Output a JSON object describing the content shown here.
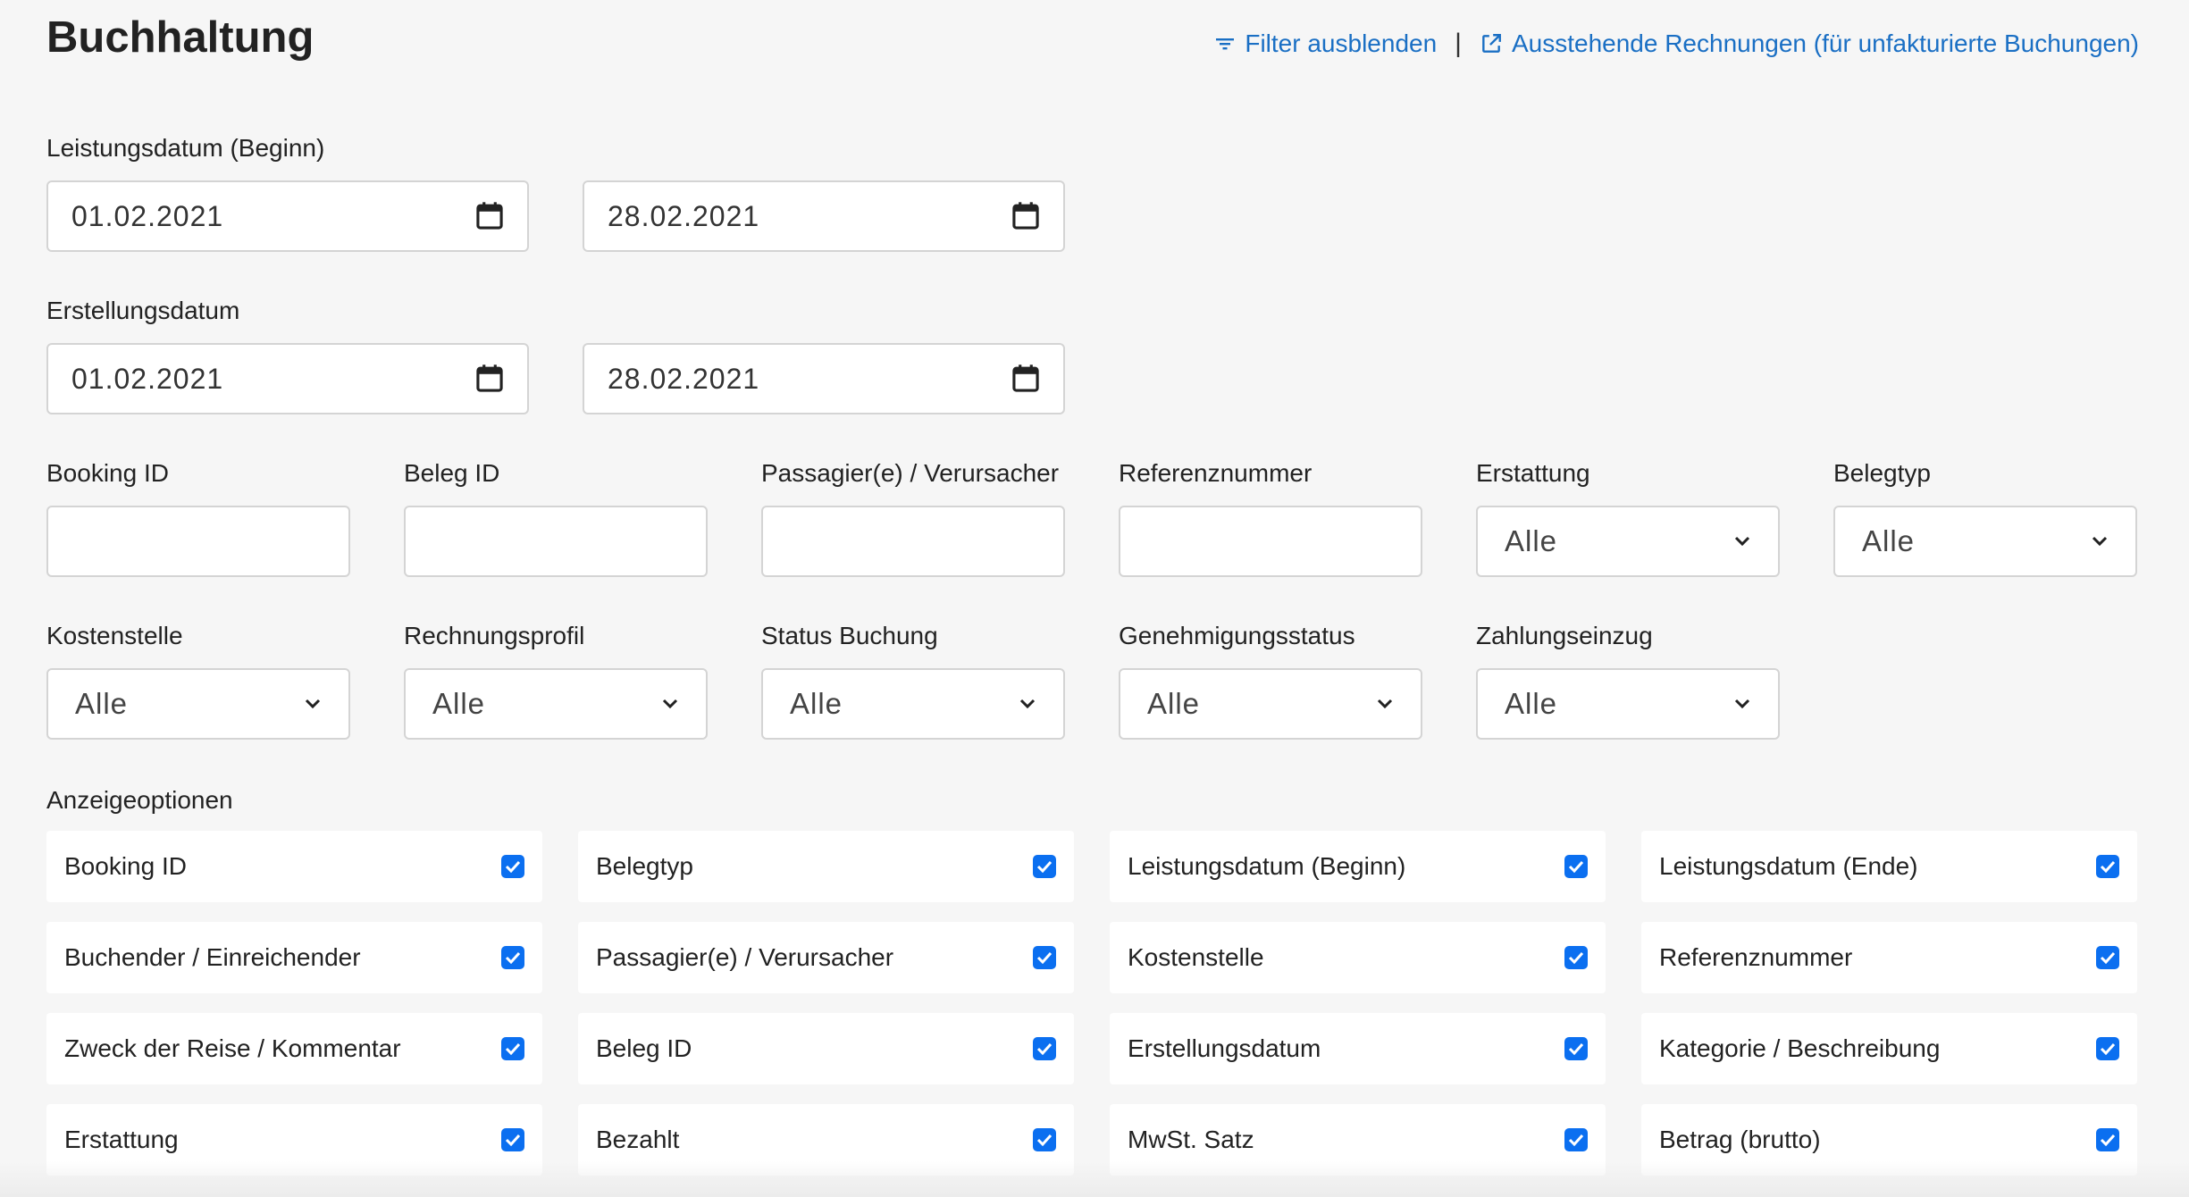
{
  "header": {
    "title": "Buchhaltung",
    "filter_link": "Filter ausblenden",
    "separator": "|",
    "pending_link": "Ausstehende Rechnungen (für unfakturierte Buchungen)"
  },
  "leistungsdatum": {
    "label": "Leistungsdatum (Beginn)",
    "from": "01.02.2021",
    "to": "28.02.2021"
  },
  "erstellungsdatum": {
    "label": "Erstellungsdatum",
    "from": "01.02.2021",
    "to": "28.02.2021"
  },
  "text_filters": [
    {
      "label": "Booking ID",
      "value": ""
    },
    {
      "label": "Beleg ID",
      "value": ""
    },
    {
      "label": "Passagier(e) / Verursacher",
      "value": ""
    },
    {
      "label": "Referenznummer",
      "value": ""
    }
  ],
  "select_filters_row1": [
    {
      "label": "Erstattung",
      "value": "Alle"
    },
    {
      "label": "Belegtyp",
      "value": "Alle"
    }
  ],
  "select_filters_row2": [
    {
      "label": "Kostenstelle",
      "value": "Alle"
    },
    {
      "label": "Rechnungsprofil",
      "value": "Alle"
    },
    {
      "label": "Status Buchung",
      "value": "Alle"
    },
    {
      "label": "Genehmigungsstatus",
      "value": "Alle"
    },
    {
      "label": "Zahlungseinzug",
      "value": "Alle"
    }
  ],
  "display_options": {
    "label": "Anzeigeoptionen",
    "items": [
      {
        "label": "Booking ID",
        "checked": true
      },
      {
        "label": "Belegtyp",
        "checked": true
      },
      {
        "label": "Leistungsdatum (Beginn)",
        "checked": true
      },
      {
        "label": "Leistungsdatum (Ende)",
        "checked": true
      },
      {
        "label": "Buchender / Einreichender",
        "checked": true
      },
      {
        "label": "Passagier(e) / Verursacher",
        "checked": true
      },
      {
        "label": "Kostenstelle",
        "checked": true
      },
      {
        "label": "Referenznummer",
        "checked": true
      },
      {
        "label": "Zweck der Reise / Kommentar",
        "checked": true
      },
      {
        "label": "Beleg ID",
        "checked": true
      },
      {
        "label": "Erstellungsdatum",
        "checked": true
      },
      {
        "label": "Kategorie / Beschreibung",
        "checked": true
      },
      {
        "label": "Erstattung",
        "checked": true
      },
      {
        "label": "Bezahlt",
        "checked": true
      },
      {
        "label": "MwSt. Satz",
        "checked": true
      },
      {
        "label": "Betrag (brutto)",
        "checked": true
      }
    ]
  },
  "colors": {
    "link": "#1a6fc4",
    "checkbox": "#0b6ff0",
    "background": "#f6f6f6"
  }
}
